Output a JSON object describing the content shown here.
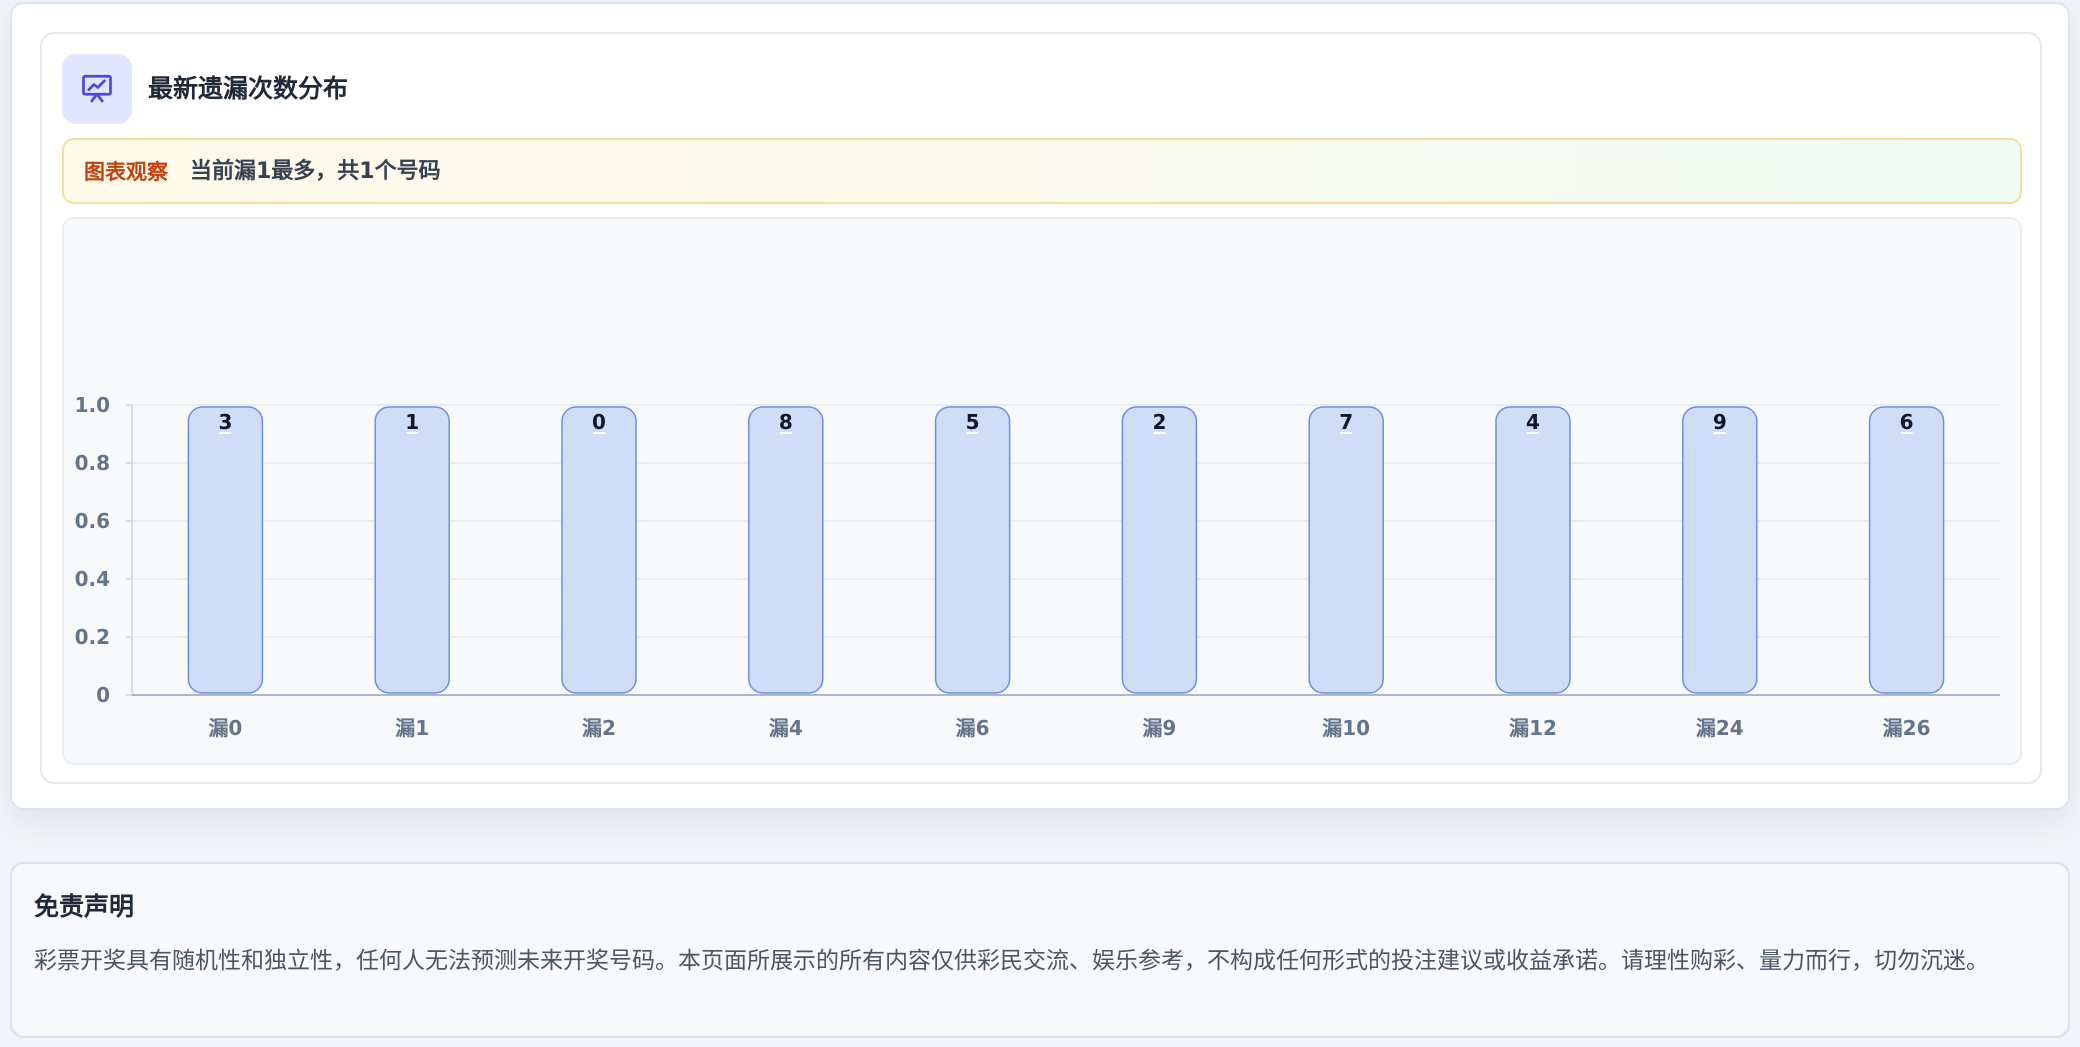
{
  "card": {
    "title": "最新遗漏次数分布",
    "icon": "presentation-chart-icon"
  },
  "insight": {
    "label": "图表观察",
    "text": "当前漏1最多，共1个号码"
  },
  "chart_data": {
    "type": "bar",
    "categories": [
      "漏0",
      "漏1",
      "漏2",
      "漏4",
      "漏6",
      "漏9",
      "漏10",
      "漏12",
      "漏24",
      "漏26"
    ],
    "values": [
      1,
      1,
      1,
      1,
      1,
      1,
      1,
      1,
      1,
      1
    ],
    "bar_labels": [
      "3",
      "1",
      "0",
      "8",
      "5",
      "2",
      "7",
      "4",
      "9",
      "6"
    ],
    "yticks": [
      "0",
      "0.2",
      "0.4",
      "0.6",
      "0.8",
      "1.0"
    ],
    "ylim": [
      0,
      1
    ],
    "grid": true,
    "bar_color": "#d0ddf6",
    "bar_border": "#6b8fe0"
  },
  "disclaimer": {
    "title": "免责声明",
    "text": "彩票开奖具有随机性和独立性，任何人无法预测未来开奖号码。本页面所展示的所有内容仅供彩民交流、娱乐参考，不构成任何形式的投注建议或收益承诺。请理性购彩、量力而行，切勿沉迷。"
  }
}
